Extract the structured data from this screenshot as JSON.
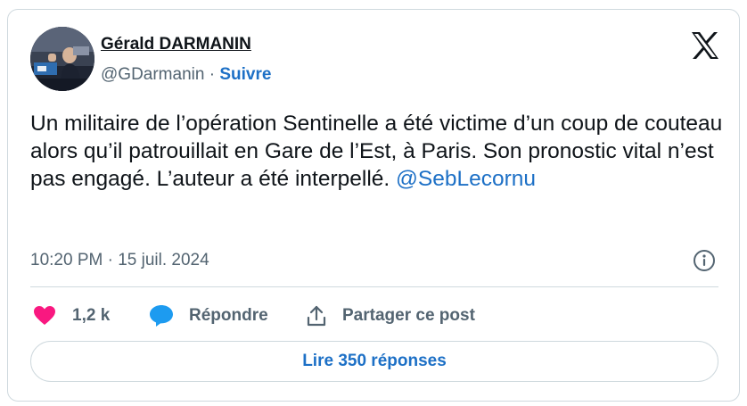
{
  "author": {
    "name": "Gérald DARMANIN",
    "handle": "@GDarmanin",
    "separator": "·",
    "follow_label": "Suivre"
  },
  "tweet": {
    "text": "Un militaire de l’opération Sentinelle a été victime d’un coup de couteau alors qu’il patrouillait en Gare de l’Est, à Paris. Son pronostic vital n’est pas engagé. L’auteur a été interpellé.",
    "mention": "@SebLecornu",
    "timestamp": "10:20 PM · 15 juil. 2024"
  },
  "actions": {
    "likes_count": "1,2 k",
    "reply_label": "Répondre",
    "share_label": "Partager ce post"
  },
  "read_replies_label": "Lire 350 réponses",
  "icons": {
    "logo": "x-logo-icon",
    "info": "info-icon",
    "like": "heart-icon",
    "reply": "speech-bubble-icon",
    "share": "share-upload-icon"
  },
  "colors": {
    "link": "#1d70c6",
    "heart": "#f91880",
    "reply_bubble": "#1d9bf0",
    "text": "#0f1419",
    "muted": "#536471",
    "border": "#cfd9de"
  }
}
